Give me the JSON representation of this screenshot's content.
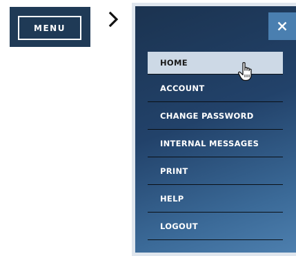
{
  "trigger": {
    "label": "MENU"
  },
  "panel": {
    "close_label": "×",
    "items": [
      {
        "label": "HOME",
        "state": "hover"
      },
      {
        "label": "ACCOUNT"
      },
      {
        "label": "CHANGE PASSWORD"
      },
      {
        "label": "INTERNAL MESSAGES"
      },
      {
        "label": "PRINT"
      },
      {
        "label": "HELP"
      },
      {
        "label": "LOGOUT"
      }
    ]
  },
  "icons": {
    "arrow": "chevron-right-icon",
    "close": "close-icon",
    "cursor": "hand-pointer-icon"
  },
  "colors": {
    "trigger_bg": "#1f3a56",
    "panel_dark": "#1b3350",
    "panel_light": "#4d7fae",
    "hover_bg": "#cdd9e6",
    "close_bg": "#4a7fb0"
  }
}
